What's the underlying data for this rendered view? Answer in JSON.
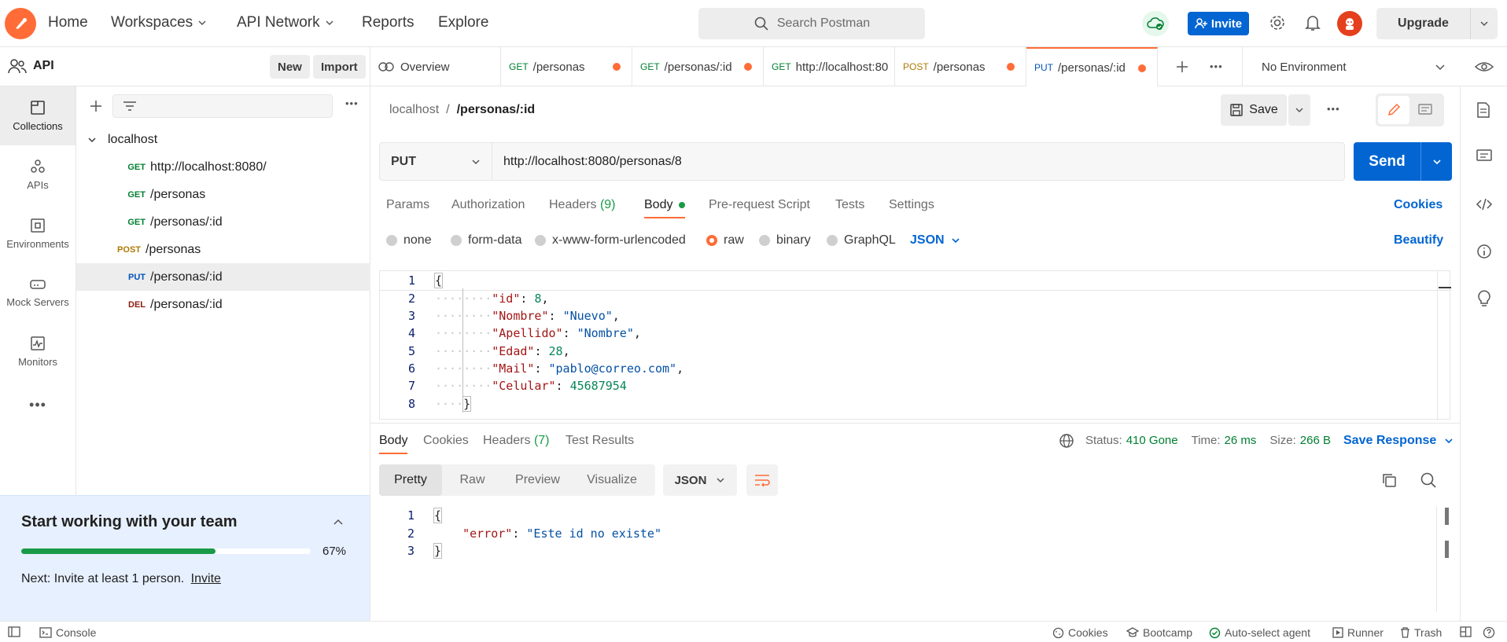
{
  "header": {
    "nav": [
      "Home",
      "Workspaces",
      "API Network",
      "Reports",
      "Explore"
    ],
    "search_placeholder": "Search Postman",
    "invite_label": "Invite",
    "upgrade_label": "Upgrade"
  },
  "workspace": {
    "name": "API",
    "new_label": "New",
    "import_label": "Import"
  },
  "rail": [
    "Collections",
    "APIs",
    "Environments",
    "Mock Servers",
    "Monitors"
  ],
  "tree": {
    "collection": "localhost",
    "items": [
      {
        "method": "GET",
        "path": "http://localhost:8080/"
      },
      {
        "method": "GET",
        "path": "/personas"
      },
      {
        "method": "GET",
        "path": "/personas/:id"
      },
      {
        "method": "POST",
        "path": "/personas"
      },
      {
        "method": "PUT",
        "path": "/personas/:id"
      },
      {
        "method": "DEL",
        "path": "/personas/:id"
      }
    ]
  },
  "team": {
    "title": "Start working with your team",
    "progress_pct": 67,
    "progress_label": "67%",
    "next_text": "Next: Invite at least 1 person.",
    "next_link": "Invite"
  },
  "tabs": {
    "overview": "Overview",
    "items": [
      {
        "method": "GET",
        "path": "/personas"
      },
      {
        "method": "GET",
        "path": "/personas/:id"
      },
      {
        "method": "GET",
        "path": "http://localhost:80"
      },
      {
        "method": "POST",
        "path": "/personas"
      },
      {
        "method": "PUT",
        "path": "/personas/:id"
      }
    ],
    "environment": "No Environment"
  },
  "request": {
    "breadcrumb_root": "localhost",
    "breadcrumb_sep": "/",
    "breadcrumb_name": "/personas/:id",
    "save_label": "Save",
    "method": "PUT",
    "url": "http://localhost:8080/personas/8",
    "send_label": "Send",
    "subtabs": {
      "params": "Params",
      "authorization": "Authorization",
      "headers": "Headers",
      "headers_count": "(9)",
      "body": "Body",
      "prerequest": "Pre-request Script",
      "tests": "Tests",
      "settings": "Settings"
    },
    "cookies_label": "Cookies",
    "body_types": [
      "none",
      "form-data",
      "x-www-form-urlencoded",
      "raw",
      "binary",
      "GraphQL"
    ],
    "body_format": "JSON",
    "beautify_label": "Beautify",
    "body_lines": [
      "1",
      "2",
      "3",
      "4",
      "5",
      "6",
      "7",
      "8"
    ],
    "body_json": {
      "id": "8",
      "nombre_key": "\"Nombre\"",
      "nombre_val": "\"Nuevo\"",
      "apellido_key": "\"Apellido\"",
      "apellido_val": "\"Nombre\"",
      "edad_key": "\"Edad\"",
      "edad_val": "28",
      "mail_key": "\"Mail\"",
      "mail_val": "\"pablo@correo.com\"",
      "celular_key": "\"Celular\"",
      "celular_val": "45687954"
    }
  },
  "response": {
    "tabs": {
      "body": "Body",
      "cookies": "Cookies",
      "headers": "Headers",
      "headers_count": "(7)",
      "tests": "Test Results"
    },
    "status_label": "Status:",
    "status_value": "410 Gone",
    "time_label": "Time:",
    "time_value": "26 ms",
    "size_label": "Size:",
    "size_value": "266 B",
    "save_response": "Save Response",
    "views": [
      "Pretty",
      "Raw",
      "Preview",
      "Visualize"
    ],
    "format": "JSON",
    "lines": [
      "1",
      "2",
      "3"
    ],
    "error_key": "\"error\"",
    "error_val": "\"Este id no existe\""
  },
  "footer": {
    "console": "Console",
    "cookies": "Cookies",
    "bootcamp": "Bootcamp",
    "auto_select": "Auto-select agent",
    "runner": "Runner",
    "trash": "Trash"
  }
}
